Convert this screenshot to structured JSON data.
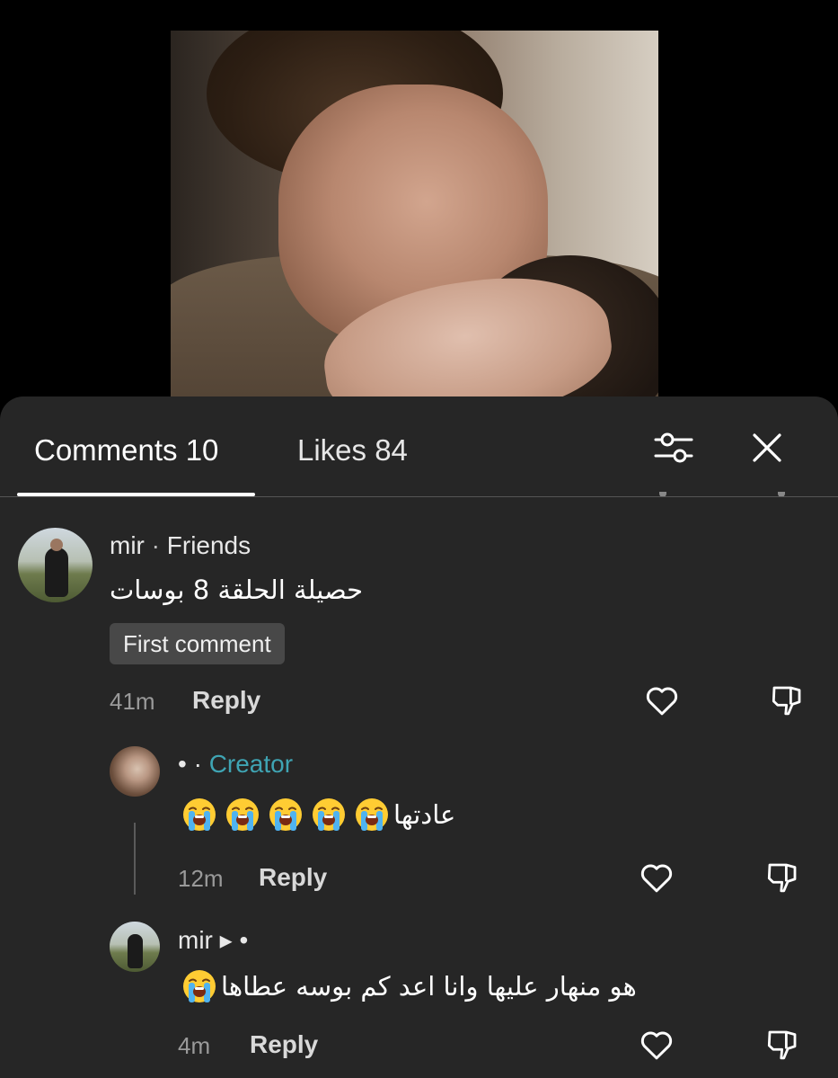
{
  "tabs": {
    "comments_label": "Comments 10",
    "likes_label": "Likes 84"
  },
  "icons": {
    "filter": "sliders-icon",
    "close": "close-icon",
    "like": "heart-icon",
    "dislike": "thumbs-down-icon",
    "emoji": "loudly-crying-face"
  },
  "comments": [
    {
      "username": "mir",
      "separator": " · ",
      "tag": "Friends",
      "text": "حصيلة الحلقة 8 بوسات",
      "badge": "First comment",
      "time": "41m",
      "reply_label": "Reply"
    }
  ],
  "replies": [
    {
      "username": "• ·",
      "tag": "Creator",
      "text": "عادتها",
      "emoji_count": 5,
      "time": "12m",
      "reply_label": "Reply"
    },
    {
      "username": "mir",
      "suffix": " ▸ •",
      "text": "هو منهار عليها وانا اعد كم بوسه عطاها",
      "emoji_count": 1,
      "time": "4m",
      "reply_label": "Reply"
    }
  ],
  "colors": {
    "sheet_bg": "#262626",
    "creator_accent": "#3fa4b3",
    "badge_bg": "#484848"
  }
}
